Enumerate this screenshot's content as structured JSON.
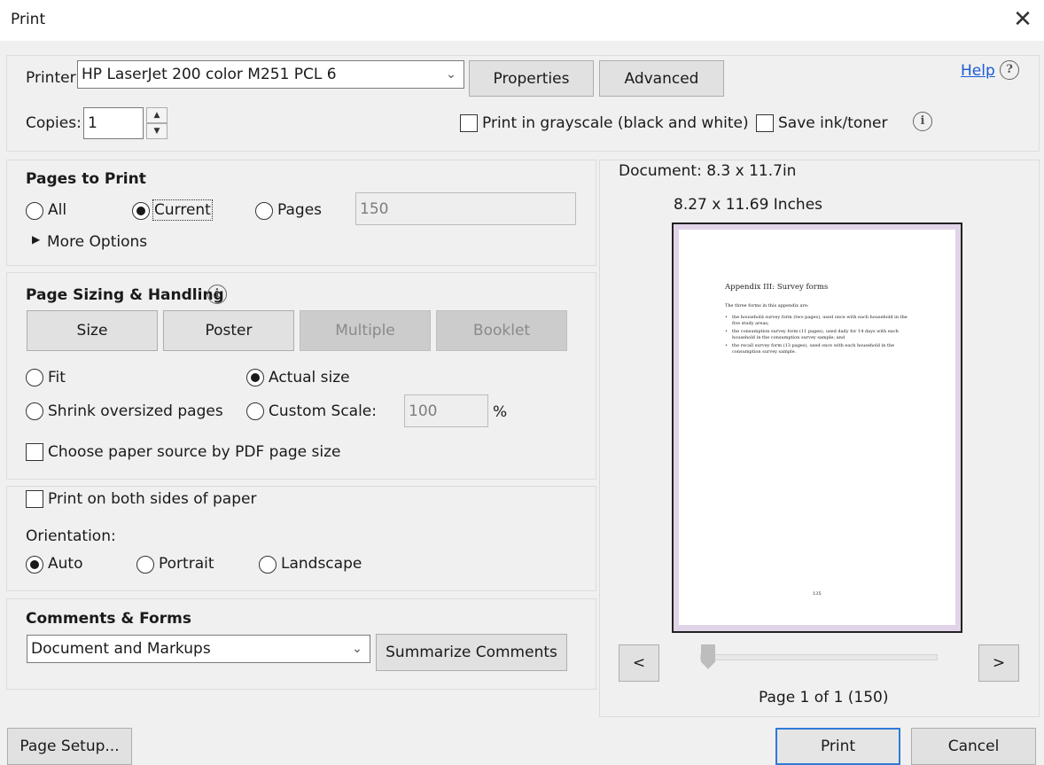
{
  "window": {
    "title": "Print"
  },
  "printer": {
    "label": "Printer:",
    "selected": "HP LaserJet 200 color M251 PCL 6",
    "properties_label": "Properties",
    "advanced_label": "Advanced",
    "help_label": "Help"
  },
  "copies": {
    "label": "Copies:",
    "value": "1"
  },
  "options": {
    "grayscale_label": "Print in grayscale (black and white)",
    "save_ink_label": "Save ink/toner"
  },
  "pages_to_print": {
    "heading": "Pages to Print",
    "all_label": "All",
    "current_label": "Current",
    "pages_label": "Pages",
    "pages_placeholder": "150",
    "more_options_label": "More Options"
  },
  "sizing": {
    "heading": "Page Sizing & Handling",
    "size_label": "Size",
    "poster_label": "Poster",
    "multiple_label": "Multiple",
    "booklet_label": "Booklet",
    "fit_label": "Fit",
    "actual_size_label": "Actual size",
    "shrink_label": "Shrink oversized pages",
    "custom_scale_label": "Custom Scale:",
    "custom_scale_value": "100",
    "percent_label": "%",
    "paper_source_label": "Choose paper source by PDF page size"
  },
  "duplex": {
    "label": "Print on both sides of paper"
  },
  "orientation": {
    "label": "Orientation:",
    "auto_label": "Auto",
    "portrait_label": "Portrait",
    "landscape_label": "Landscape"
  },
  "comments": {
    "heading": "Comments & Forms",
    "selected": "Document and Markups",
    "summarize_label": "Summarize Comments"
  },
  "preview": {
    "document_size": "Document: 8.3 x 11.7in",
    "paper_size": "8.27 x 11.69 Inches",
    "page_title": "Appendix III: Survey forms",
    "page_intro": "The three forms in this appendix are:",
    "bullets": [
      "the household survey form (two pages), used once with each household in the five study areas;",
      "the consumption survey form (11 pages), used daily for 14 days with each household in the consumption survey sample; and",
      "the recall survey form (13 pages), used once with each household in the consumption survey sample."
    ],
    "page_number": "135",
    "prev_label": "<",
    "next_label": ">",
    "page_status": "Page 1 of 1 (150)"
  },
  "footer": {
    "page_setup_label": "Page Setup...",
    "print_label": "Print",
    "cancel_label": "Cancel"
  }
}
